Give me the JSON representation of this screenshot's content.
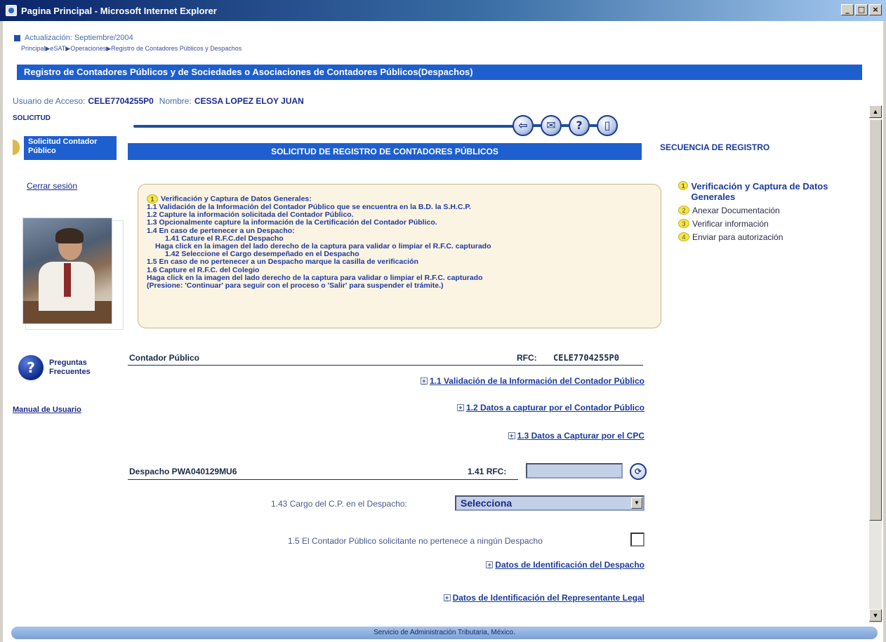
{
  "window": {
    "title": "Pagina Principal - Microsoft Internet Explorer",
    "minimize": "_",
    "maximize": "□",
    "close": "×"
  },
  "header": {
    "update": "Actualización: Septiembre/2004",
    "breadcrumb": "Principal▶eSAT▶Operaciones▶Registro de Contadores Públicos y Despachos",
    "banner": "Registro de Contadores Públicos y de Sociedades o Asociaciones de Contadores Públicos(Despachos)"
  },
  "user": {
    "access_label": "Usuario de Acceso:",
    "access_value": "CELE7704255P0",
    "name_label": "Nombre:",
    "name_value": "CESSA LOPEZ ELOY JUAN"
  },
  "sidebar": {
    "section": "SOLICITUD",
    "active_item": "Solicitud Contador Público",
    "logout": "Cerrar sesión",
    "faq": "Preguntas Frecuentes",
    "manual": "Manual de Usuario"
  },
  "toolbar": {
    "icons": [
      "back-icon",
      "mail-icon",
      "help-icon",
      "exit-icon"
    ]
  },
  "main": {
    "section_title": "SOLICITUD DE REGISTRO DE CONTADORES PÚBLICOS",
    "instructions": {
      "badge": "1",
      "title": "Verificación y Captura de Datos Generales:",
      "lines": [
        {
          "text": "1.1 Validación de la Información del Contador Público que se encuentra en la B.D. la S.H.C.P.",
          "indent": 0
        },
        {
          "text": "1.2 Capture la información solicitada del Contador Público.",
          "indent": 0
        },
        {
          "text": "1.3 Opcionalmente capture la información de la Certificación del Contador Público.",
          "indent": 0
        },
        {
          "text": "1.4 En caso de pertenecer a un Despacho:",
          "indent": 0
        },
        {
          "text": "1.41 Cature el R.F.C.del Despacho",
          "indent": 2
        },
        {
          "text": "Haga click en la imagen del lado derecho de la captura para validar o limpiar el R.F.C. capturado",
          "indent": 1
        },
        {
          "text": "1.42 Seleccione el Cargo desempeñado en el Despacho",
          "indent": 2
        },
        {
          "text": "1.5 En caso de no pertenecer a un Despacho marque la casilla de verificación",
          "indent": 0
        },
        {
          "text": "1.6 Capture el R.F.C. del Colegio",
          "indent": 0
        },
        {
          "text": "Haga click en la imagen del lado derecho de la captura para validar o limpiar el R.F.C. capturado",
          "indent": 0
        },
        {
          "text": "(Presione: 'Continuar' para seguir con el proceso o 'Salir' para suspender el trámite.)",
          "indent": 0
        }
      ]
    },
    "contador_label": "Contador Público",
    "rfc_label": "RFC:",
    "rfc_value": "CELE7704255P0",
    "links": {
      "l11": "1.1 Validación de la Información del Contador Público",
      "l12": "1.2 Datos a capturar por el Contador Público",
      "l13": "1.3 Datos a Capturar por el CPC",
      "despacho_id": "Datos de Identificación del Despacho",
      "representante": "Datos de Identificación del Representante Legal"
    },
    "despacho_label": "Despacho PWA040129MU6",
    "rfc141_label": "1.41 RFC:",
    "rfc141_value": "",
    "cargo_label": "1.43 Cargo del C.P. en el Despacho:",
    "cargo_selected": "Selecciona",
    "no_despacho_label": "1.5 El Contador Público solicitante no pertenece a ningún Despacho"
  },
  "sequence": {
    "title": "SECUENCIA DE REGISTRO",
    "items": [
      {
        "num": "1",
        "label": "Verificación y Captura de Datos Generales",
        "active": true
      },
      {
        "num": "2",
        "label": "Anexar Documentación",
        "active": false
      },
      {
        "num": "3",
        "label": "Verificar información",
        "active": false
      },
      {
        "num": "4",
        "label": "Enviar para autorización",
        "active": false
      }
    ]
  },
  "footer": {
    "text": "Servicio de Administración Tributaria, México."
  },
  "colors": {
    "accent": "#1e5fcf",
    "link": "#1a3a9a",
    "infobox_bg": "#fbf4e2"
  }
}
